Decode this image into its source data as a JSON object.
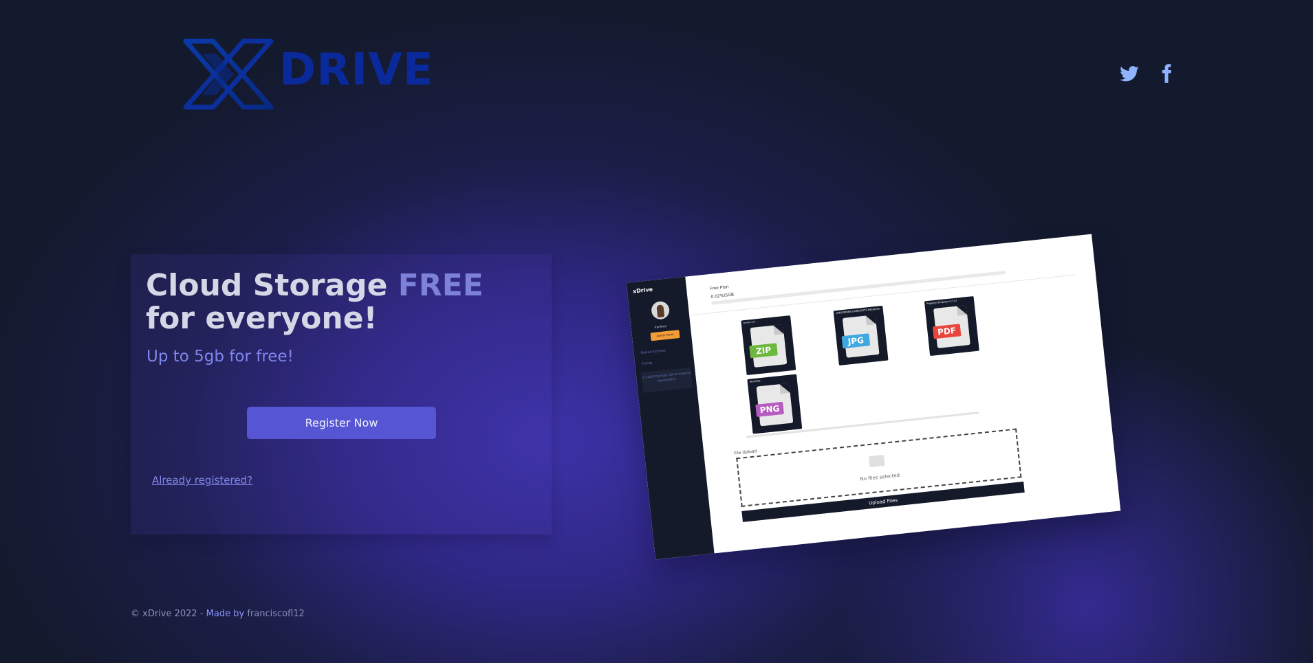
{
  "header": {
    "logo_text": "DRIVE",
    "social": [
      {
        "icon": "twitter-icon",
        "label": "Twitter"
      },
      {
        "icon": "facebook-icon",
        "label": "Facebook"
      }
    ]
  },
  "hero": {
    "headline_part1": "Cloud Storage ",
    "headline_highlight": "FREE",
    "headline_part2": " for everyone!",
    "subheadline": "Up to 5gb for free!",
    "register_label": "Register Now",
    "login_link": "Already registered?"
  },
  "preview": {
    "brand": "xDrive",
    "username": "franfixen",
    "admin_label": "Admin Panel",
    "nav": [
      "Shared Archives",
      "Pricing"
    ],
    "copyright": "© 2022 Copyright: xDrive made by franciscofl12",
    "plan": "Free Plan",
    "usage": "0.02%/5GB",
    "files": [
      {
        "name": "errors-1.0",
        "ext": "ZIP",
        "color": "#6fb83f"
      },
      {
        "name": "1649298888-1648833475-84b3ac01-1ee2-4f6a-9744-2fa23a6f4a8 (1)",
        "ext": "JPG",
        "color": "#3fa8e0"
      },
      {
        "name": "Property Simpreso (1) (1)",
        "ext": "PDF",
        "color": "#e8453c"
      },
      {
        "name": "descarga",
        "ext": "PNG",
        "color": "#b65bbf"
      }
    ],
    "upload_title": "File Upload",
    "no_files": "No files selected",
    "upload_button": "Upload Files"
  },
  "footer": {
    "copyright": "© xDrive 2022 -",
    "made_by": " Made by ",
    "author": "franciscofl12"
  },
  "colors": {
    "accent": "#5656d4",
    "highlight": "#7d81d8",
    "link": "#7f86ee",
    "logo": "#0a2a9c"
  }
}
